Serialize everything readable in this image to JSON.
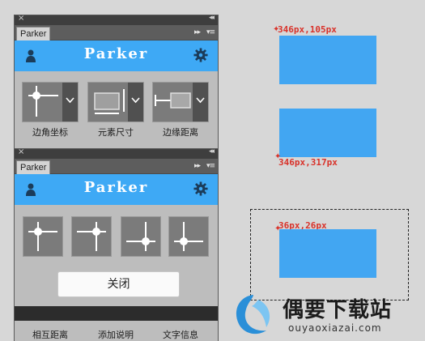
{
  "panel_top": {
    "tab": "Parker",
    "brand": "Parker",
    "tools": [
      {
        "label": "边角坐标",
        "icon": "corner-coordinate-icon"
      },
      {
        "label": "元素尺寸",
        "icon": "element-size-icon"
      },
      {
        "label": "边缘距离",
        "icon": "edge-distance-icon"
      }
    ]
  },
  "panel_bottom": {
    "tab": "Parker",
    "brand": "Parker",
    "corner_options": [
      "top-left-corner-icon",
      "top-right-corner-icon",
      "bottom-right-corner-icon",
      "bottom-left-corner-icon"
    ],
    "close_label": "关闭",
    "bottom_labels": [
      "相互距离",
      "添加说明",
      "文字信息"
    ]
  },
  "demo": {
    "coord1": "346px,105px",
    "coord2": "346px,317px",
    "coord3": "36px,26px"
  },
  "watermark": {
    "title": "偶要下载站",
    "url": "ouyaoxiazai.com"
  },
  "colors": {
    "accent": "#3ea9f5",
    "marker": "#d8322a",
    "box": "#42a6f2"
  }
}
